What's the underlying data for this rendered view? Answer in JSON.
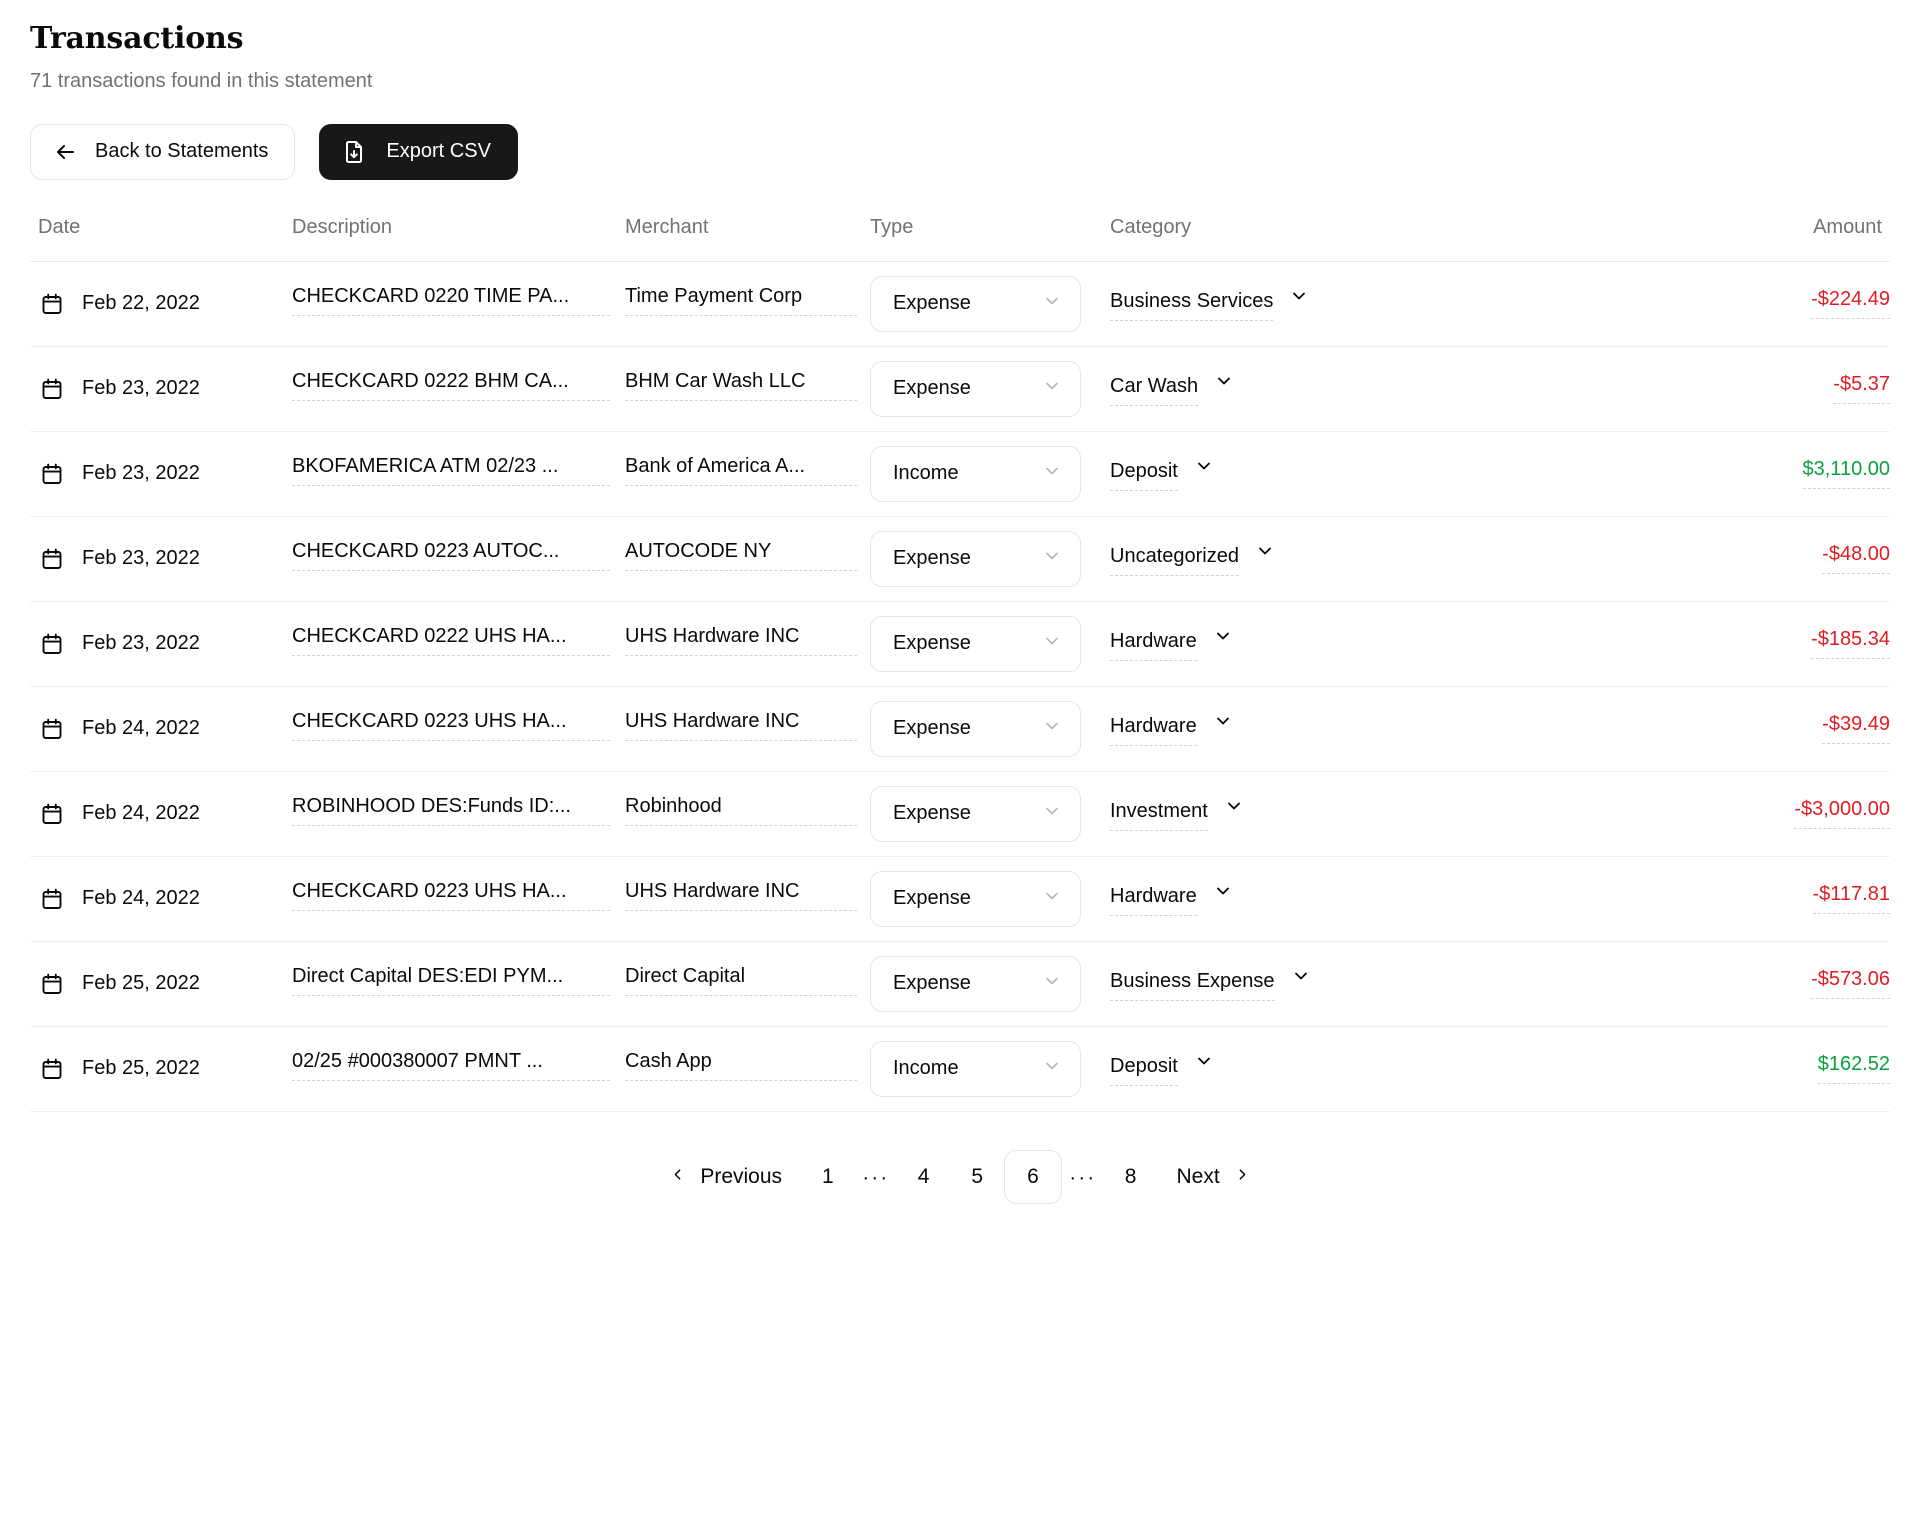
{
  "header": {
    "title": "Transactions",
    "subtitle": "71 transactions found in this statement"
  },
  "toolbar": {
    "back_label": "Back to Statements",
    "export_label": "Export CSV",
    "back_icon": "arrow-left-icon",
    "export_icon": "file-download-icon"
  },
  "table": {
    "columns": [
      "Date",
      "Description",
      "Merchant",
      "Type",
      "Category",
      "Amount"
    ],
    "rows": [
      {
        "date": "Feb 22, 2022",
        "description": "CHECKCARD 0220 TIME PA...",
        "merchant": "Time Payment Corp",
        "type": "Expense",
        "category": "Business Services",
        "amount": "-$224.49",
        "amount_sign": "negative"
      },
      {
        "date": "Feb 23, 2022",
        "description": "CHECKCARD 0222 BHM CA...",
        "merchant": "BHM Car Wash LLC",
        "type": "Expense",
        "category": "Car Wash",
        "amount": "-$5.37",
        "amount_sign": "negative"
      },
      {
        "date": "Feb 23, 2022",
        "description": "BKOFAMERICA ATM 02/23 ...",
        "merchant": "Bank of America A...",
        "type": "Income",
        "category": "Deposit",
        "amount": "$3,110.00",
        "amount_sign": "positive"
      },
      {
        "date": "Feb 23, 2022",
        "description": "CHECKCARD 0223 AUTOC...",
        "merchant": "AUTOCODE NY",
        "type": "Expense",
        "category": "Uncategorized",
        "amount": "-$48.00",
        "amount_sign": "negative"
      },
      {
        "date": "Feb 23, 2022",
        "description": "CHECKCARD 0222 UHS HA...",
        "merchant": "UHS Hardware INC",
        "type": "Expense",
        "category": "Hardware",
        "amount": "-$185.34",
        "amount_sign": "negative"
      },
      {
        "date": "Feb 24, 2022",
        "description": "CHECKCARD 0223 UHS HA...",
        "merchant": "UHS Hardware INC",
        "type": "Expense",
        "category": "Hardware",
        "amount": "-$39.49",
        "amount_sign": "negative"
      },
      {
        "date": "Feb 24, 2022",
        "description": "ROBINHOOD DES:Funds ID:...",
        "merchant": "Robinhood",
        "type": "Expense",
        "category": "Investment",
        "amount": "-$3,000.00",
        "amount_sign": "negative"
      },
      {
        "date": "Feb 24, 2022",
        "description": "CHECKCARD 0223 UHS HA...",
        "merchant": "UHS Hardware INC",
        "type": "Expense",
        "category": "Hardware",
        "amount": "-$117.81",
        "amount_sign": "negative"
      },
      {
        "date": "Feb 25, 2022",
        "description": "Direct Capital DES:EDI PYM...",
        "merchant": "Direct Capital",
        "type": "Expense",
        "category": "Business Expense",
        "amount": "-$573.06",
        "amount_sign": "negative"
      },
      {
        "date": "Feb 25, 2022",
        "description": "02/25 #000380007 PMNT ...",
        "merchant": "Cash App",
        "type": "Income",
        "category": "Deposit",
        "amount": "$162.52",
        "amount_sign": "positive"
      }
    ]
  },
  "pagination": {
    "previous_label": "Previous",
    "next_label": "Next",
    "ellipsis": "···",
    "items": [
      "1",
      "···",
      "4",
      "5",
      "6",
      "···",
      "8"
    ],
    "current_page": "6"
  },
  "colors": {
    "negative": "#e11d22",
    "positive": "#0aa13c",
    "primary_button": "#18181b",
    "muted_text": "#71717a"
  }
}
